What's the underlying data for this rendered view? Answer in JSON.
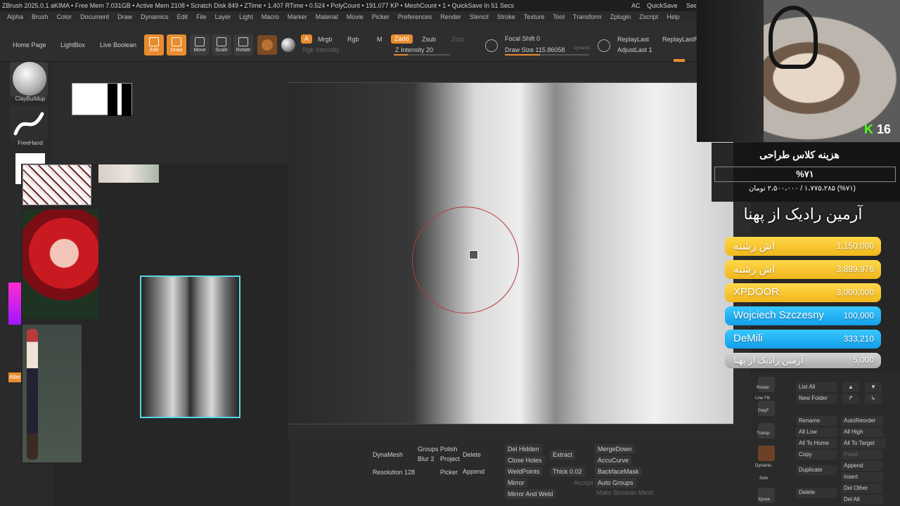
{
  "status": {
    "left": "ZBrush 2025.0.1    aKIMA    • Free Mem 7.031GB • Active Mem 2108 • Scratch Disk 849 • ZTime • 1.407 RTime • 0.524 • PolyCount • 191.077 KP • MeshCount • 1 • QuickSave In 51 Secs",
    "ac": "AC",
    "quicksave": "QuickSave",
    "see": "See"
  },
  "menu": [
    "Alpha",
    "Brush",
    "Color",
    "Document",
    "Draw",
    "Dynamics",
    "Edit",
    "File",
    "Layer",
    "Light",
    "Macro",
    "Marker",
    "Material",
    "Movie",
    "Picker",
    "Preferences",
    "Render",
    "Stencil",
    "Stroke",
    "Texture",
    "Tool",
    "Transform",
    "Zplugin",
    "Zscript",
    "Help"
  ],
  "toolbar": {
    "home": "Home Page",
    "lightbox": "LightBox",
    "live_boolean": "Live Boolean",
    "edit": "Edit",
    "draw": "Draw",
    "move": "Move",
    "scale": "Scale",
    "rotate": "Rotate",
    "a": "A",
    "mrgb": "Mrgb",
    "rgb": "Rgb",
    "m": "M",
    "rgb_intensity": "Rgb Intensity",
    "zadd": "Zadd",
    "zsub": "Zsub",
    "zcut": "Zcut",
    "z_intensity": "Z Intensity 20",
    "focal_shift": "Focal Shift 0",
    "draw_size": "Draw Size 115.86058",
    "dynamic": "Dynamic",
    "replay_last": "ReplayLast",
    "replay_last_rel": "ReplayLastRel",
    "adjust_last": "AdjustLast 1"
  },
  "shelf": {
    "brush1": "ClayBuildup",
    "brush2": "FreeHand",
    "alter": "Alter"
  },
  "bottom": {
    "dynamesh": "DynaMesh",
    "groups": "Groups",
    "polish": "Polish",
    "blur": "Blur 2",
    "project": "Project",
    "resolution": "Resolution 128",
    "picker": "Picker",
    "delete": "Delete",
    "append": "Append",
    "del_hidden": "Del Hidden",
    "close_holes": "Close Holes",
    "weldpoints": "WeldPoints",
    "mirror": "Mirror",
    "mirror_and_weld": "Mirror And Weld",
    "extract": "Extract",
    "thick": "Thick 0.02",
    "accept": "Accept",
    "merge_down": "MergeDown",
    "accucurve": "AccuCurve",
    "backface_mask": "BackfaceMask",
    "auto_groups": "Auto Groups",
    "make_boolean_mesh": "Make Boolean Mesh"
  },
  "stream": {
    "kick_count": "16",
    "donate_title": "هزینه کلاس طراحی",
    "donate_percent": "%۷۱",
    "donate_amount": "(%۷۱) ۱،۷۷۵،۲۸۵ / ۲،۵۰۰،۰۰۰ تومان",
    "top_title": "آرمین رادیک از پهنا",
    "donations": [
      {
        "name": "اش رشته",
        "amount": "1,150,000",
        "color": "yellow"
      },
      {
        "name": "اش رشته",
        "amount": "3,889,976",
        "color": "yellow"
      },
      {
        "name": "XPDOOR",
        "amount": "3,000,000",
        "color": "yellow"
      },
      {
        "name": "Wojciech Szczesny",
        "amount": "100,000",
        "color": "blue"
      },
      {
        "name": "DeMili",
        "amount": "333,210",
        "color": "blue"
      },
      {
        "name": "آرمین رادیک از پهنا",
        "amount": "5,000",
        "color": "gray"
      }
    ]
  },
  "right": {
    "list_all": "List All",
    "new_folder": "New Folder",
    "rename": "Rename",
    "auto_reorder": "AutoReorder",
    "all_low": "All Low",
    "all_high": "All High",
    "all_to_home": "All To Home",
    "all_to_target": "All To Target",
    "copy": "Copy",
    "paste": "Paste",
    "duplicate": "Duplicate",
    "append": "Append",
    "insert": "Insert",
    "delete": "Delete",
    "del_other": "Del Other",
    "del_all": "Del All",
    "rotate": "Rotate",
    "line_fill": "Line Fill",
    "polyf": "PolyF",
    "transp": "Transp",
    "dynamic": "Dynamic",
    "solo": "Solo",
    "xpose": "Xpose"
  }
}
